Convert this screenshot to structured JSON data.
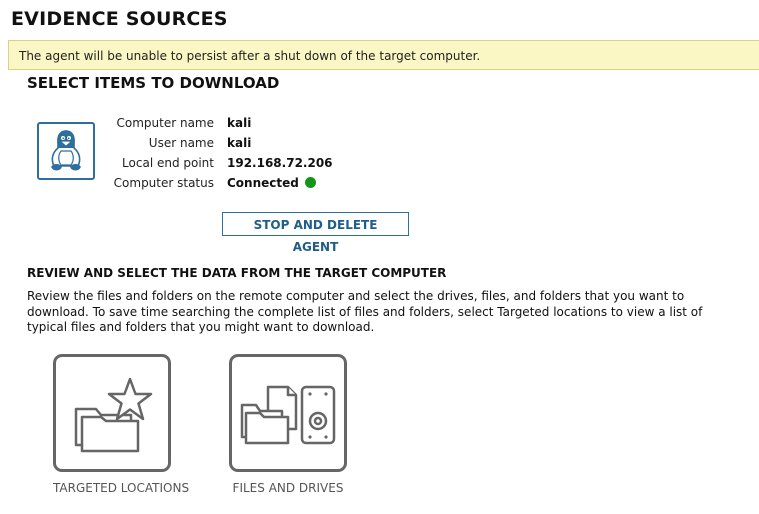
{
  "page": {
    "title": "EVIDENCE SOURCES"
  },
  "warning": {
    "text": "The agent will be unable to persist after a shut down of the target computer."
  },
  "select_section": {
    "title": "SELECT ITEMS TO DOWNLOAD"
  },
  "computer": {
    "icon": "linux-tux-icon",
    "name_label": "Computer name",
    "name_value": "kali",
    "user_label": "User name",
    "user_value": "kali",
    "endpoint_label": "Local end point",
    "endpoint_value": "192.168.72.206",
    "status_label": "Computer status",
    "status_value": "Connected",
    "status_color": "#12961a"
  },
  "actions": {
    "stop_delete_label": "STOP AND DELETE AGENT"
  },
  "review": {
    "title": "REVIEW AND SELECT THE DATA FROM THE TARGET COMPUTER",
    "description": "Review the files and folders on the remote computer and select the drives, files, and folders that you want to download. To save time searching the complete list of files and folders, select Targeted locations to view a list of typical files and folders that you might want to download."
  },
  "options": [
    {
      "label": "TARGETED LOCATIONS",
      "icon": "folder-star-icon"
    },
    {
      "label": "FILES AND DRIVES",
      "icon": "files-drive-icon"
    }
  ],
  "colors": {
    "accent": "#2e6f9e",
    "warning_background": "#fbf7c4",
    "tile_border": "#666666"
  }
}
